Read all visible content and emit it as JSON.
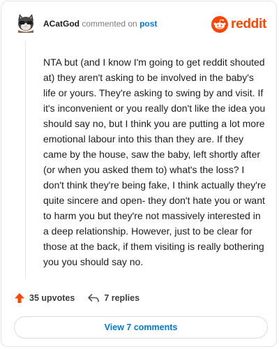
{
  "header": {
    "username": "ACatGod",
    "action_text": "commented on",
    "post_link": "post"
  },
  "brand": {
    "wordmark": "reddit",
    "accent_color": "#ff4500",
    "icon": "reddit-alien-icon"
  },
  "comment": {
    "body": "NTA but (and I know I'm going to get reddit shouted at) they aren't asking to be involved in the baby's life or yours. They're asking to swing by and visit. If it's inconvenient or you really don't like the idea you should say no, but I think you are putting a lot more emotional labour into this than they are. If they came by the house, saw the baby, left shortly after (or when you asked them to) what's the loss? I don't think they're being fake, I think actually they're quite sincere and open- they don't hate you or want to harm you but they're not massively interested in a deep relationship. However, just to be clear for those at the back, if them visiting is really bothering you you should say no."
  },
  "actions": {
    "upvotes_label": "35 upvotes",
    "replies_label": "7 replies",
    "upvote_icon": "upvote-arrow-icon",
    "reply_icon": "reply-arrow-icon"
  },
  "footer": {
    "view_comments_label": "View 7 comments"
  },
  "colors": {
    "link": "#0079d3",
    "upvote": "#ff4500"
  }
}
